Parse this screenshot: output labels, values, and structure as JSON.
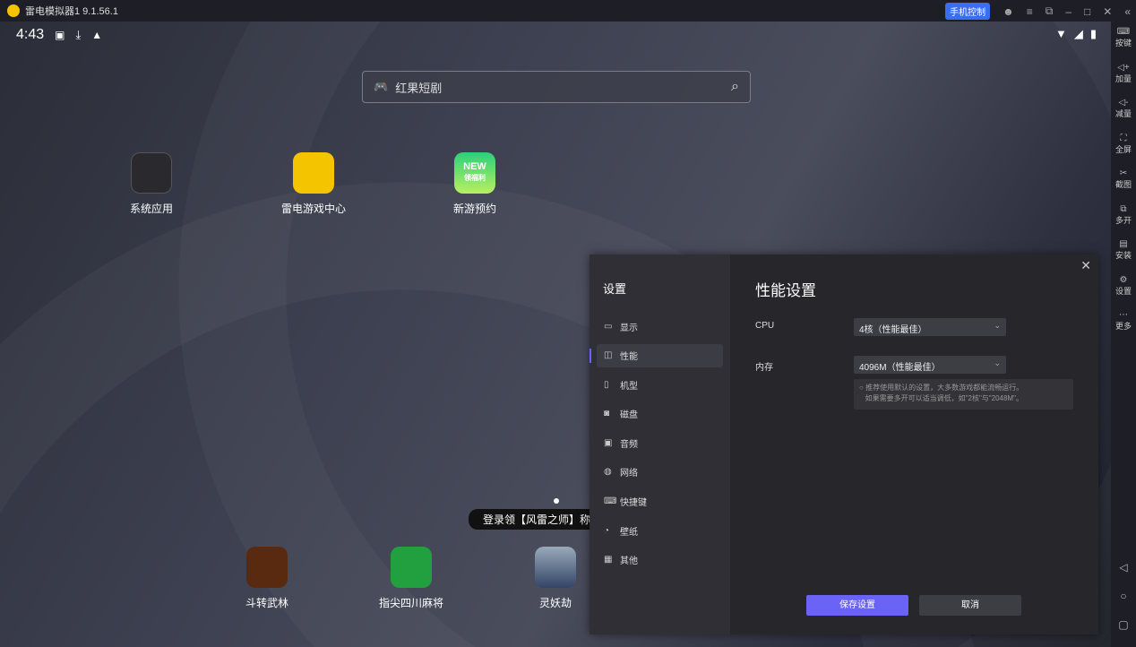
{
  "titlebar": {
    "title": "雷电模拟器1 9.1.56.1",
    "phone_control": "手机控制",
    "menu_icons": [
      "avatar-icon",
      "menu-icon",
      "popout-icon",
      "minimize-icon",
      "maximize-icon",
      "close-icon",
      "collapse-icon"
    ]
  },
  "status": {
    "time": "4:43"
  },
  "search": {
    "placeholder": "红果短剧"
  },
  "desktop_apps": [
    {
      "label": "系统应用"
    },
    {
      "label": "雷电游戏中心"
    },
    {
      "label": "新游预约",
      "badge": "NEW",
      "sub": "领福利"
    }
  ],
  "tooltip": "登录领【风雷之师】称",
  "dock_apps": [
    {
      "label": "斗转武林"
    },
    {
      "label": "指尖四川麻将"
    },
    {
      "label": "灵妖劫"
    }
  ],
  "sidebar": [
    {
      "label": "按键"
    },
    {
      "label": "加量"
    },
    {
      "label": "减量"
    },
    {
      "label": "全屏"
    },
    {
      "label": "截图"
    },
    {
      "label": "多开"
    },
    {
      "label": "安装"
    },
    {
      "label": "设置"
    },
    {
      "label": "更多"
    }
  ],
  "settings": {
    "title": "设置",
    "nav": [
      {
        "label": "显示"
      },
      {
        "label": "性能"
      },
      {
        "label": "机型"
      },
      {
        "label": "磁盘"
      },
      {
        "label": "音频"
      },
      {
        "label": "网络"
      },
      {
        "label": "快捷键"
      },
      {
        "label": "壁纸"
      },
      {
        "label": "其他"
      }
    ],
    "active": "性能",
    "page_title": "性能设置",
    "cpu_label": "CPU",
    "cpu_value": "4核（性能最佳）",
    "mem_label": "内存",
    "mem_value": "4096M（性能最佳）",
    "hint1": "推荐使用默认的设置，大多数游戏都能流畅运行。",
    "hint2": "如果需要多开可以适当调低，如\"2核\"与\"2048M\"。",
    "save": "保存设置",
    "cancel": "取消"
  },
  "accent": "#6b63f6"
}
